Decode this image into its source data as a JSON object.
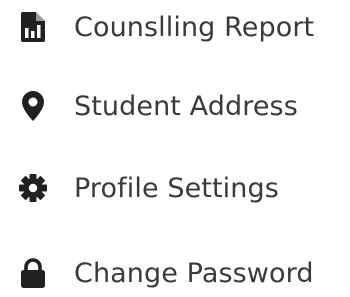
{
  "menu": {
    "items": [
      {
        "label": "Counslling Report",
        "icon": "report-document-icon"
      },
      {
        "label": "Student Address",
        "icon": "map-pin-icon"
      },
      {
        "label": "Profile Settings",
        "icon": "gear-icon"
      },
      {
        "label": "Change Password",
        "icon": "lock-icon"
      }
    ]
  },
  "colors": {
    "icon": "#212121",
    "text": "#3a3a3a",
    "background": "#ffffff"
  }
}
